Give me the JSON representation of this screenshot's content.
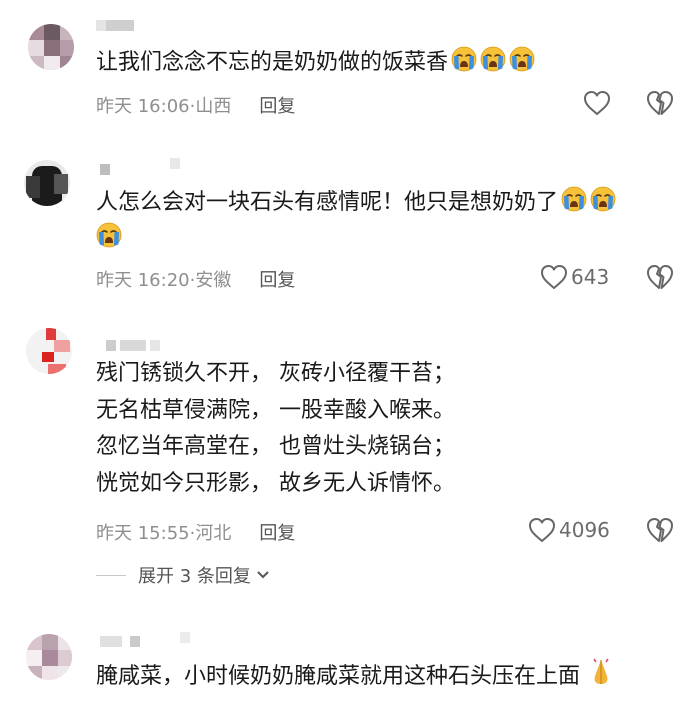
{
  "comments": [
    {
      "text": "让我们念念不忘的是奶奶做的饭菜香",
      "emojis": [
        "crying-face",
        "crying-face",
        "crying-face"
      ],
      "time": "昨天 16:06",
      "location": "山西",
      "reply_label": "回复",
      "likes": ""
    },
    {
      "text": "人怎么会对一块石头有感情呢！他只是想奶奶了",
      "emojis": [
        "crying-face",
        "crying-face",
        "crying-face"
      ],
      "time": "昨天 16:20",
      "location": "安徽",
      "reply_label": "回复",
      "likes": "643"
    },
    {
      "lines": [
        "残门锈锁久不开，  灰砖小径覆干苔；",
        "无名枯草侵满院，  一股幸酸入喉来。",
        "忽忆当年高堂在，  也曾灶头烧锅台；",
        "恍觉如今只形影，  故乡无人诉情怀。"
      ],
      "time": "昨天 15:55",
      "location": "河北",
      "reply_label": "回复",
      "likes": "4096",
      "expand_label": "展开 3 条回复"
    },
    {
      "text": "腌咸菜，小时候奶奶腌咸菜就用这种石头压在上面",
      "emojis": [
        "hands-pressed-together"
      ]
    }
  ],
  "icons": {
    "like": "heart-outline-icon",
    "dislike": "broken-heart-icon",
    "expand": "chevron-down-icon"
  },
  "colors": {
    "emoji_face": "#f7c23a",
    "emoji_tears": "#3d8fe0",
    "meta_gray": "#8f8f8f"
  }
}
